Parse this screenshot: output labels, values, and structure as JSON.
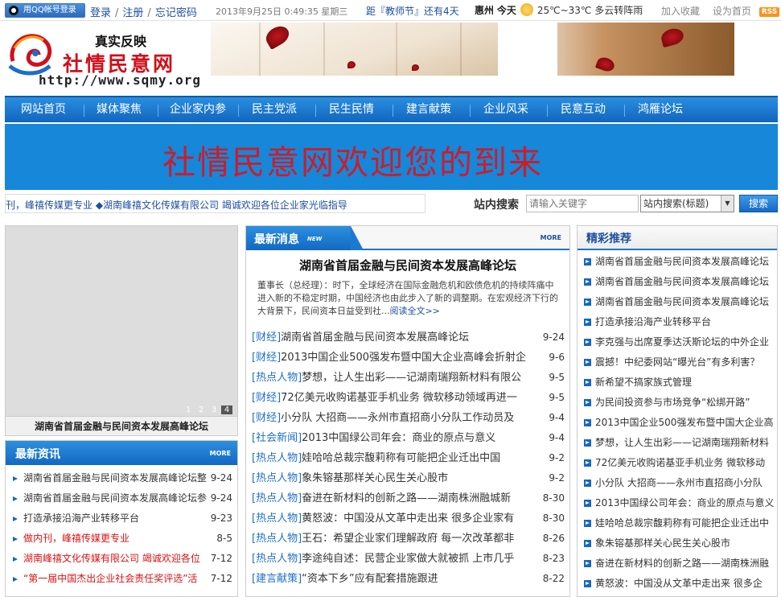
{
  "topbar": {
    "qq_login": "用QQ帐号登录",
    "login": "登录",
    "register": "注册",
    "forgot": "忘记密码",
    "date": "2013年9月25日  0:49:35  星期三",
    "countdown": "距『教师节』还有4天",
    "city": "惠州",
    "today": "今天",
    "weather": "25℃~33℃ 多云转阵雨",
    "bookmark": "加入收藏",
    "homepage": "设为首页",
    "rss": "RSS"
  },
  "logo": {
    "slogan": "真实反映",
    "name": "社情民意网",
    "url": "http://www.sqmy.org"
  },
  "nav": {
    "items": [
      "网站首页",
      "媒体聚焦",
      "企业家内参",
      "民主党派",
      "民生民情",
      "建言献策",
      "企业风采",
      "民意互动",
      "鸿雁论坛"
    ]
  },
  "welcome": {
    "text": "社情民意网欢迎您的到来"
  },
  "ticker": {
    "text": "刊，峰禧传媒更专业    ◆湖南峰禧文化传媒有限公司 竭诚欢迎各位企业家光临指导"
  },
  "search": {
    "label": "站内搜索",
    "placeholder": "请输入关键字",
    "scope": "站内搜索(标题)",
    "button": "搜索"
  },
  "slideshow": {
    "numbers": [
      "1",
      "2",
      "3",
      "4"
    ],
    "active": "4",
    "caption": "湖南省首届金融与民间资本发展高峰论坛"
  },
  "latest_info": {
    "title": "最新资讯",
    "more": "MORE",
    "items": [
      {
        "title": "湖南省首届金融与民间资本发展高峰论坛整",
        "date": "9-24",
        "red": false
      },
      {
        "title": "湖南省首届金融与民间资本发展高峰论坛参",
        "date": "9-24",
        "red": false
      },
      {
        "title": "打造承接沿海产业转移平台",
        "date": "9-23",
        "red": false
      },
      {
        "title": "做内刊，峰禧传媒更专业",
        "date": "8-5",
        "red": true
      },
      {
        "title": "湖南峰禧文化传媒有限公司 竭诚欢迎各位",
        "date": "7-12",
        "red": true
      },
      {
        "title": "“第一届中国杰出企业社会责任奖评选”活",
        "date": "7-12",
        "red": true
      }
    ]
  },
  "latest_news": {
    "title": "最新消息",
    "new_tag": "NEW",
    "more": "MORE",
    "headline": "湖南省首届金融与民间资本发展高峰论坛",
    "summary": "董事长（总经理）：时下，全球经济在国际金融危机和欧债危机的持续阵痛中进入新的不稳定时期，中国经济也由此步入了新的调整期。在宏观经济下行的大背景下，民间资本日益受到社...",
    "read_all": "阅读全文>>",
    "items": [
      {
        "cat": "[财经]",
        "title": "湖南省首届金融与民间资本发展高峰论坛",
        "date": "9-24"
      },
      {
        "cat": "[财经]",
        "title": "2013中国企业500强发布暨中国大企业高峰会折射企",
        "date": "9-6"
      },
      {
        "cat": "[热点人物]",
        "title": "梦想，让人生出彩——记湖南瑞翔新材料有限公",
        "date": "9-5"
      },
      {
        "cat": "[财经]",
        "title": "72亿美元收购诺基亚手机业务 微软移动领域再进一",
        "date": "9-5"
      },
      {
        "cat": "[财经]",
        "title": "小分队 大招商——永州市直招商小分队工作动员及",
        "date": "9-4"
      },
      {
        "cat": "[社会新闻]",
        "title": "2013中国绿公司年会：商业的原点与意义",
        "date": "9-4"
      },
      {
        "cat": "[热点人物]",
        "title": "娃哈哈总裁宗馥莉称有可能把企业迁出中国",
        "date": "9-2"
      },
      {
        "cat": "[热点人物]",
        "title": "象朱镕基那样关心民生关心股市",
        "date": "9-2"
      },
      {
        "cat": "[热点人物]",
        "title": "奋进在新材料的创新之路——湖南株洲融城新",
        "date": "8-30"
      },
      {
        "cat": "[热点人物]",
        "title": "黄怒波：中国没从文革中走出来 很多企业家有",
        "date": "8-30"
      },
      {
        "cat": "[热点人物]",
        "title": "王石：希望企业家们理解政府 每一次改革都非",
        "date": "8-26"
      },
      {
        "cat": "[热点人物]",
        "title": "李途纯自述：民营企业家做大就被抓 上市几乎",
        "date": "8-23"
      },
      {
        "cat": "[建言献策]",
        "title": "“资本下乡”应有配套措施跟进",
        "date": "8-22"
      }
    ]
  },
  "recommend": {
    "title": "精彩推荐",
    "items": [
      "湖南省首届金融与民间资本发展高峰论坛",
      "湖南省首届金融与民间资本发展高峰论坛",
      "湖南省首届金融与民间资本发展高峰论坛",
      "打造承接沿海产业转移平台",
      "李克强与出席夏季达沃斯论坛的中外企业",
      "震撼！中纪委网站“曝光台”有多利害？",
      "新希望不搞家族式管理",
      "为民间投资参与市场竞争“松绑开路”",
      "2013中国企业500强发布暨中国大企业高",
      "梦想，让人生出彩——记湖南瑞翔新材料",
      "72亿美元收购诺基亚手机业务 微软移动",
      "小分队 大招商——永州市直招商小分队",
      "2013中国绿公司年会：商业的原点与意义",
      "娃哈哈总裁宗馥莉称有可能把企业迁出中",
      "象朱镕基那样关心民生关心股市",
      "奋进在新材料的创新之路——湖南株洲融",
      "黄怒波：中国没从文革中走出来 很多企"
    ]
  },
  "colors": {
    "nav_blue": "#1a7ad0",
    "welcome_bg": "#1687d9",
    "welcome_text": "#cc1d2a",
    "link_blue": "#1e4fa0",
    "brand_red": "#d10f1b"
  }
}
